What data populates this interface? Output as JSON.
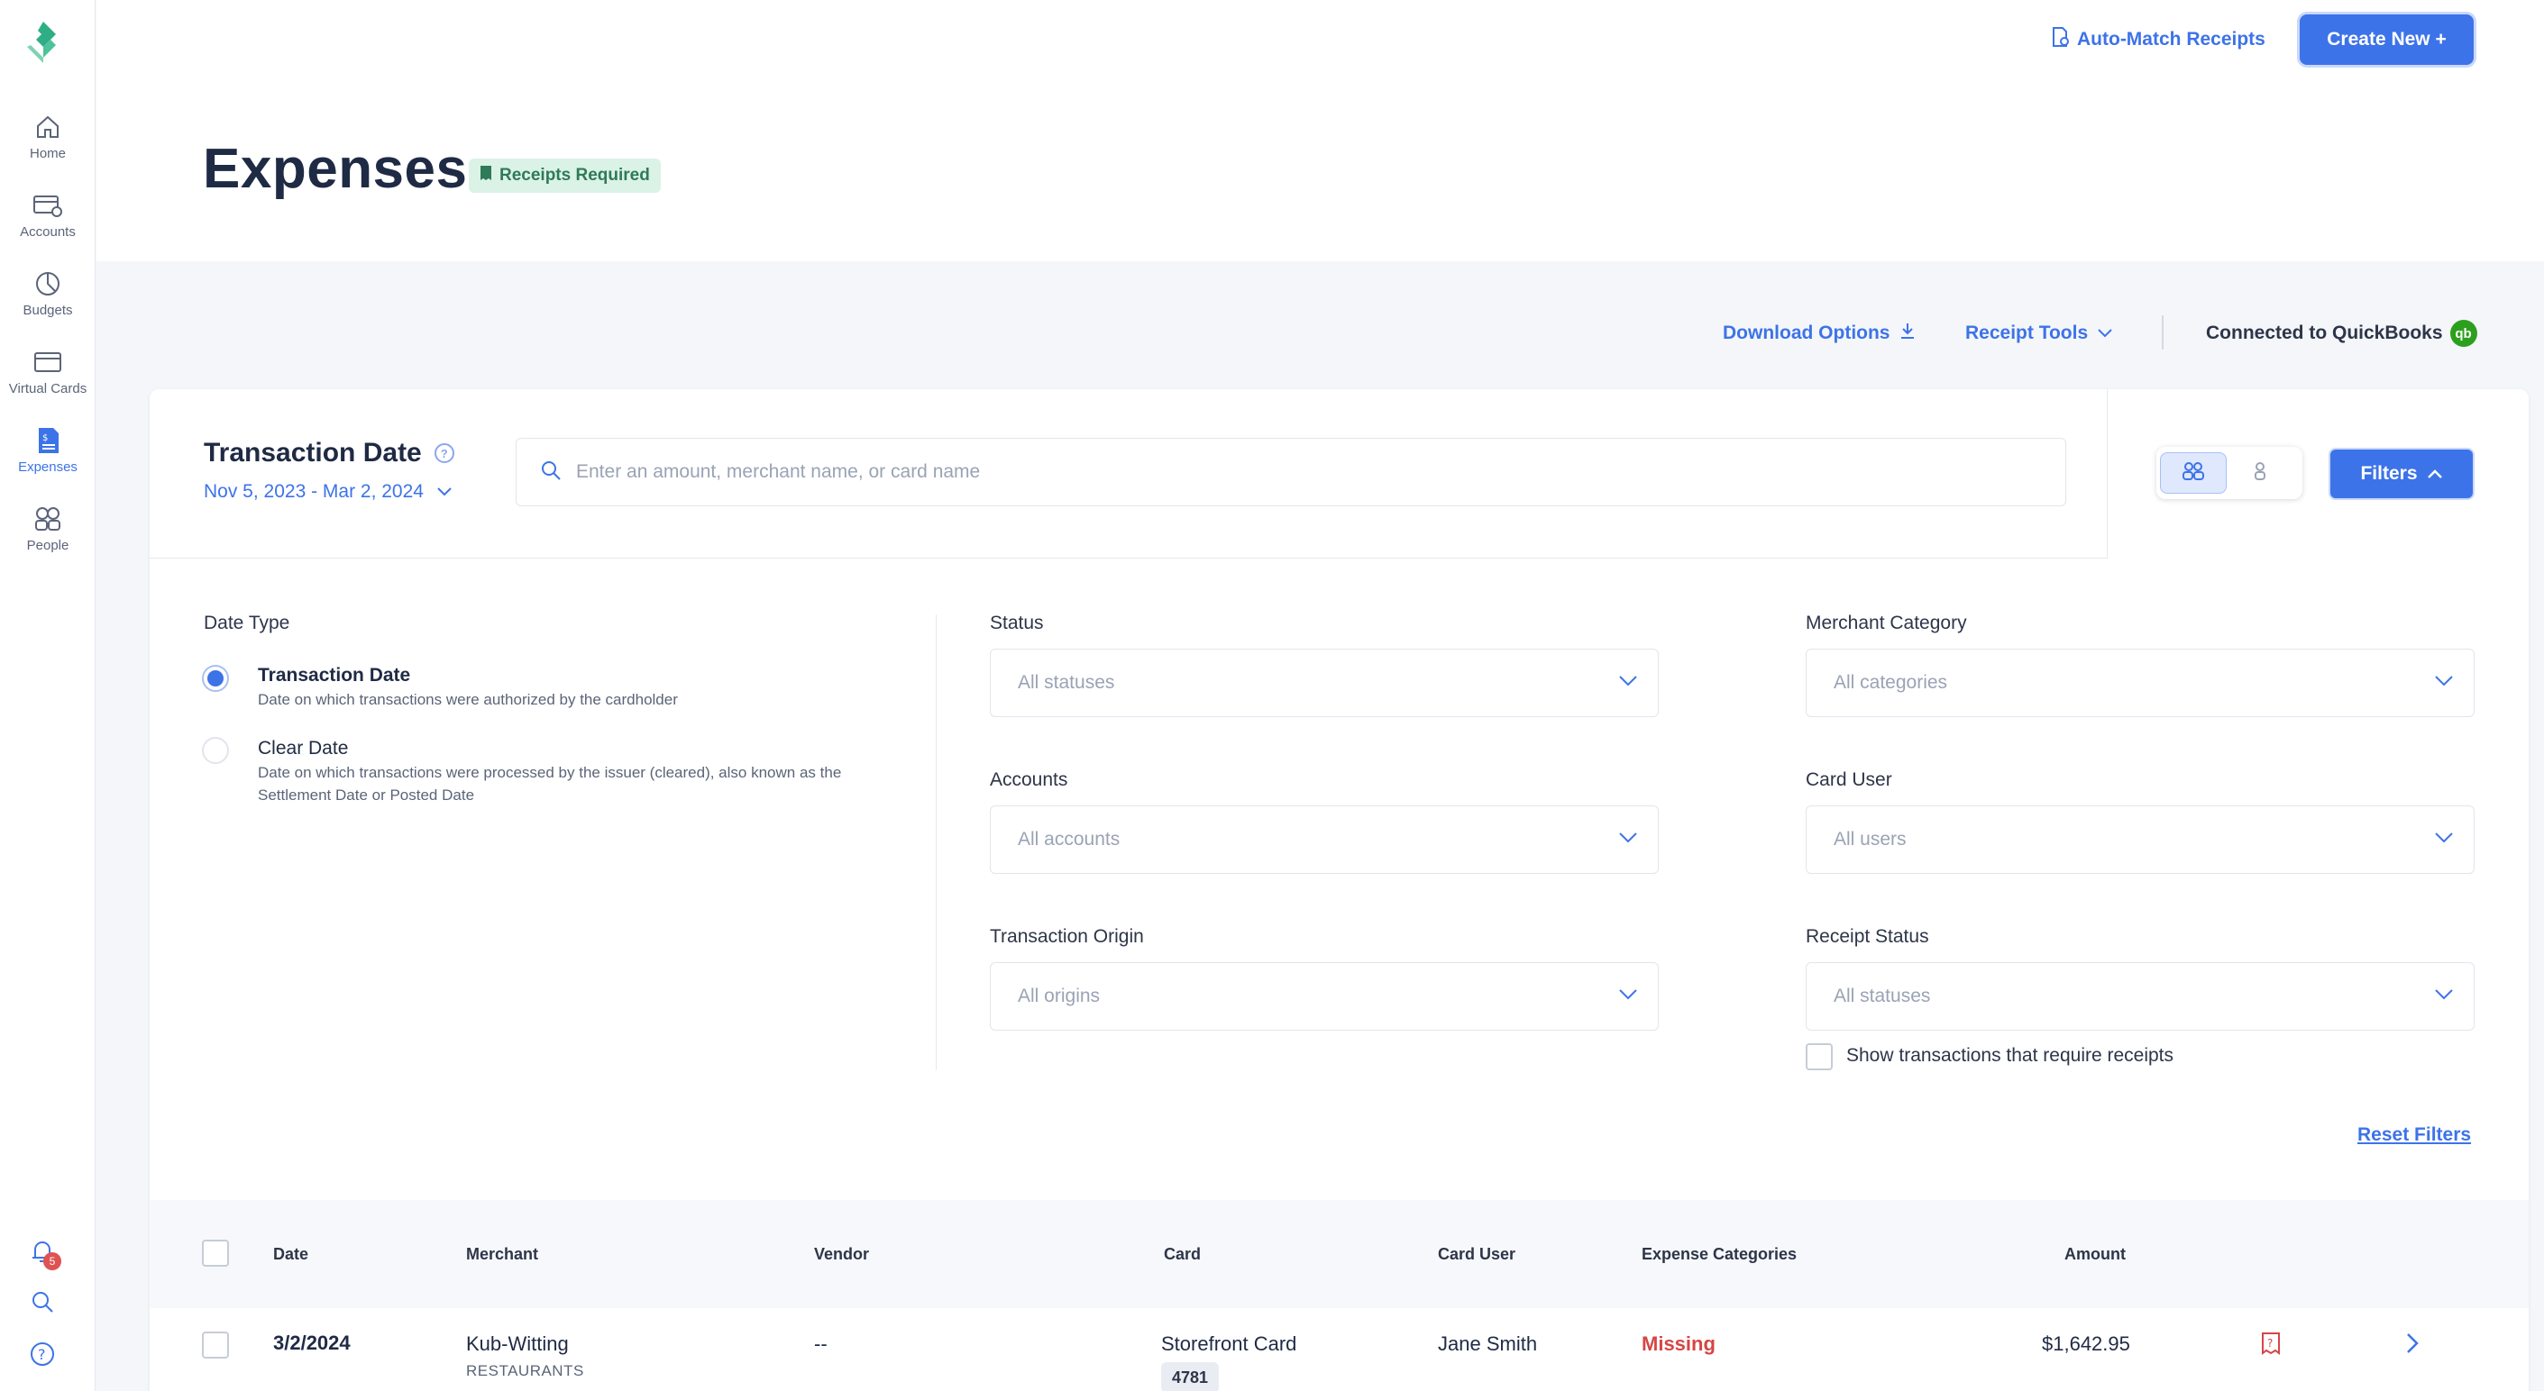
{
  "nav": {
    "items": [
      {
        "label": "Home",
        "icon": "home-icon"
      },
      {
        "label": "Accounts",
        "icon": "accounts-icon"
      },
      {
        "label": "Budgets",
        "icon": "budgets-icon"
      },
      {
        "label": "Virtual Cards",
        "icon": "virtual-cards-icon"
      },
      {
        "label": "Expenses",
        "icon": "expenses-icon",
        "active": true
      },
      {
        "label": "People",
        "icon": "people-icon"
      }
    ],
    "notification_count": "5"
  },
  "header": {
    "auto_match_label": "Auto-Match Receipts",
    "create_label": "Create New +",
    "title": "Expenses",
    "badge_label": "Receipts Required"
  },
  "toolbar": {
    "download_label": "Download Options",
    "receipt_tools_label": "Receipt Tools",
    "quickbooks_label": "Connected to QuickBooks",
    "quickbooks_logo_text": "qb"
  },
  "search": {
    "title": "Transaction Date",
    "date_range": "Nov 5, 2023 - Mar 2, 2024",
    "placeholder": "Enter an amount, merchant name, or card name",
    "filters_label": "Filters"
  },
  "filters": {
    "date_type_label": "Date Type",
    "date_types": [
      {
        "title": "Transaction Date",
        "desc": "Date on which transactions were authorized by the cardholder",
        "checked": true
      },
      {
        "title": "Clear Date",
        "desc": "Date on which transactions were processed by the issuer (cleared), also known as the Settlement Date or Posted Date",
        "checked": false
      }
    ],
    "status": {
      "label": "Status",
      "value": "All statuses"
    },
    "accounts": {
      "label": "Accounts",
      "value": "All accounts"
    },
    "origin": {
      "label": "Transaction Origin",
      "value": "All origins"
    },
    "merchant_category": {
      "label": "Merchant Category",
      "value": "All categories"
    },
    "card_user": {
      "label": "Card User",
      "value": "All users"
    },
    "receipt_status": {
      "label": "Receipt Status",
      "value": "All statuses"
    },
    "require_receipts_label": "Show transactions that require receipts",
    "reset_label": "Reset Filters"
  },
  "table": {
    "columns": [
      "Date",
      "Merchant",
      "Vendor",
      "Card",
      "Card User",
      "Expense Categories",
      "Amount"
    ],
    "rows": [
      {
        "date": "3/2/2024",
        "merchant": "Kub-Witting",
        "merchant_category": "RESTAURANTS",
        "vendor": "--",
        "card": "Storefront Card",
        "card_last4": "4781",
        "card_user": "Jane Smith",
        "expense_category": "Missing",
        "amount": "$1,642.95"
      }
    ]
  },
  "colors": {
    "accent": "#3d73e8",
    "success": "#2f7a57",
    "danger": "#d64545",
    "quickbooks": "#2ca01c"
  }
}
